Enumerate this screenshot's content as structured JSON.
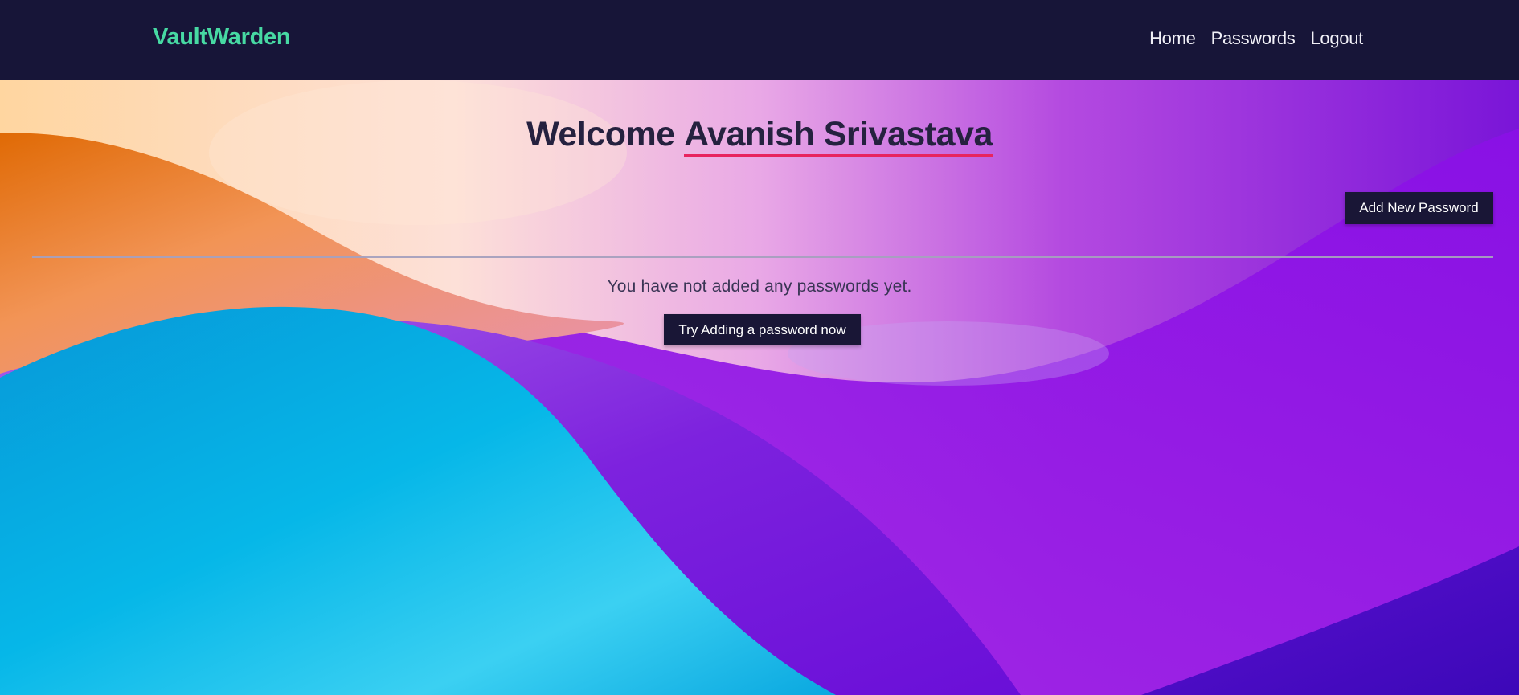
{
  "navbar": {
    "brand": "VaultWarden",
    "links": [
      "Home",
      "Passwords",
      "Logout"
    ]
  },
  "main": {
    "welcome_prefix": "Welcome ",
    "username": "Avanish Srivastava",
    "add_button": "Add New Password",
    "empty_message": "You have not added any passwords yet.",
    "try_button": "Try Adding a password now"
  },
  "colors": {
    "navbar_bg": "#171538",
    "brand": "#47d9a3",
    "button_bg": "#191636",
    "underline": "#e8245f",
    "heading": "#25213f"
  }
}
